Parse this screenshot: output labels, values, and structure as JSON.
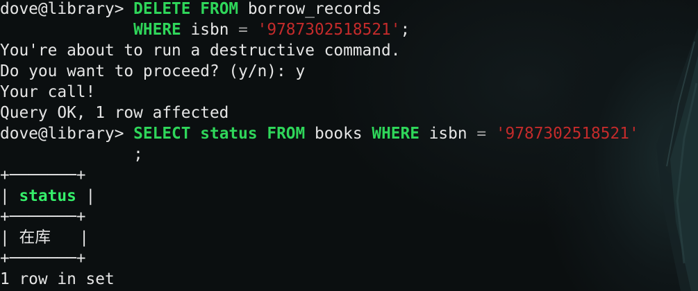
{
  "terminal": {
    "prompt": "dove@library> ",
    "continuation_indent": "              ",
    "delete_cmd": {
      "kw_delete": "DELETE",
      "kw_from": "FROM",
      "table": "borrow_records",
      "kw_where": "WHERE",
      "column": "isbn",
      "operator": "=",
      "value": "'9787302518521'",
      "terminator": ";"
    },
    "warning_line": "You're about to run a destructive command.",
    "confirm_question": "Do you want to proceed? (y/n): ",
    "confirm_answer": "y",
    "your_call": "Your call!",
    "query_ok": "Query OK, 1 row affected",
    "select_cmd": {
      "kw_select": "SELECT",
      "column_status": "status",
      "kw_from": "FROM",
      "table": "books",
      "kw_where": "WHERE",
      "column": "isbn",
      "operator": "=",
      "value": "'9787302518521'",
      "terminator": ";"
    },
    "result_table": {
      "border": "+───────+",
      "header": "status",
      "rows": [
        "在库"
      ]
    },
    "row_count": "1 row in set"
  },
  "colors": {
    "keyword": "#2fd65a",
    "string": "#c42b2b",
    "text": "#e6e6e6",
    "background": "#0b0f10"
  }
}
